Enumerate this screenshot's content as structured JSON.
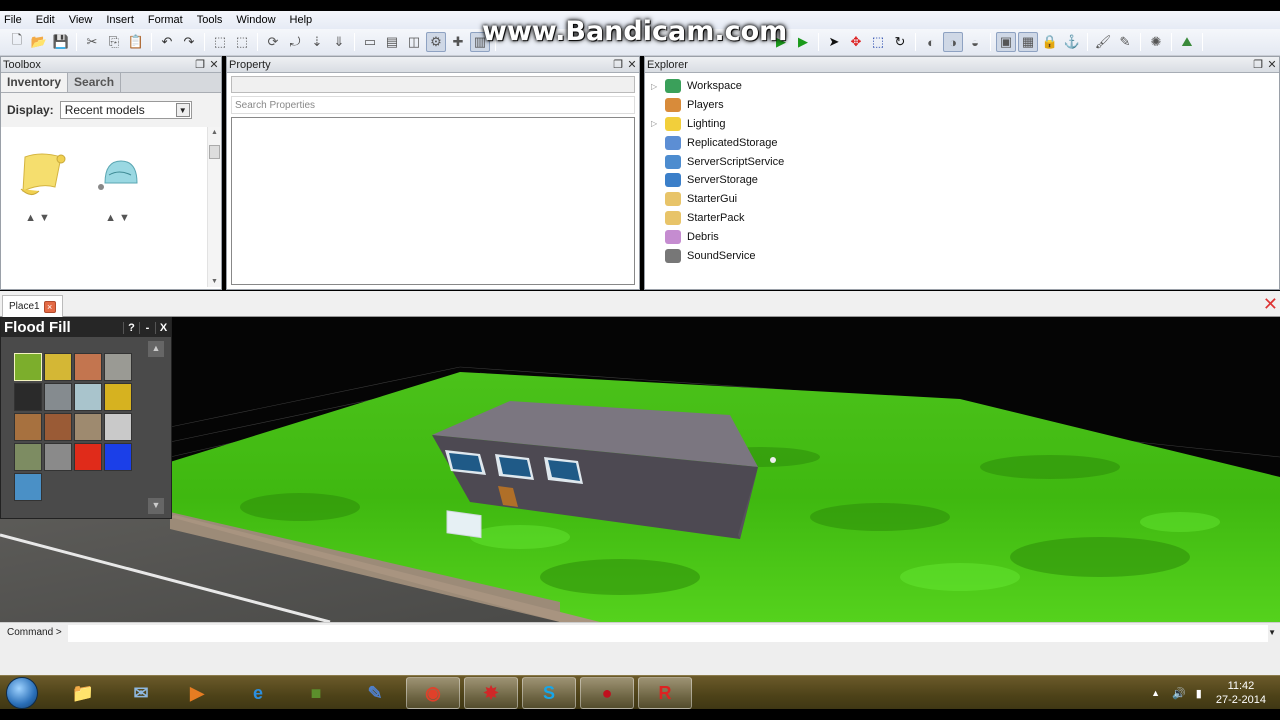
{
  "recording_watermark": "www.Bandicam.com",
  "menu": [
    "File",
    "Edit",
    "View",
    "Insert",
    "Format",
    "Tools",
    "Window",
    "Help"
  ],
  "toolbar": {
    "groups": [
      [
        "new-file-icon",
        "open-folder-icon",
        "save-icon"
      ],
      [
        "cut-icon",
        "copy-icon",
        "paste-icon"
      ],
      [
        "undo-icon",
        "redo-icon"
      ],
      [
        "group-icon",
        "ungroup-icon"
      ],
      [
        "rotate-icon",
        "tilt-icon",
        "drop-icon",
        "anchor-down-icon"
      ],
      [
        "window-icon",
        "windows-icon",
        "preview-icon",
        "tools-icon",
        "plugin-icon",
        "layout-icon"
      ],
      [
        "play-icon",
        "run-icon"
      ],
      [
        "select-icon",
        "move-icon",
        "resize-icon",
        "rotate-tool-icon"
      ],
      [
        "snap-1-icon",
        "snap-fifth-icon",
        "snap-off-icon"
      ],
      [
        "collisions-icon",
        "joints-icon",
        "lock-icon",
        "anchor-icon"
      ],
      [
        "paint-icon",
        "dropper-icon"
      ],
      [
        "material-icon"
      ],
      [
        "terrain-icon"
      ]
    ],
    "play_symbol": "▶",
    "overflow_symbol": "»"
  },
  "toolbox": {
    "title": "Toolbox",
    "tabs": [
      "Inventory",
      "Search"
    ],
    "active_tab": "Inventory",
    "display_label": "Display:",
    "display_value": "Recent models",
    "models": [
      {
        "name": "script-scroll",
        "icon": "scroll-icon"
      },
      {
        "name": "glass-dome",
        "icon": "dome-icon"
      }
    ],
    "rate_up": "👍",
    "rate_down": "👎"
  },
  "property": {
    "title": "Property",
    "search_placeholder": "Search Properties"
  },
  "explorer": {
    "title": "Explorer",
    "items": [
      {
        "label": "Workspace",
        "expandable": true,
        "color": "#3aa05a"
      },
      {
        "label": "Players",
        "expandable": false,
        "color": "#d88b3a"
      },
      {
        "label": "Lighting",
        "expandable": true,
        "color": "#f2cf3b"
      },
      {
        "label": "ReplicatedStorage",
        "expandable": false,
        "color": "#5c8ed4"
      },
      {
        "label": "ServerScriptService",
        "expandable": false,
        "color": "#4d8ccf"
      },
      {
        "label": "ServerStorage",
        "expandable": false,
        "color": "#3b7fc9"
      },
      {
        "label": "StarterGui",
        "expandable": false,
        "color": "#e8c469"
      },
      {
        "label": "StarterPack",
        "expandable": false,
        "color": "#e8c469"
      },
      {
        "label": "Debris",
        "expandable": false,
        "color": "#c58cd0"
      },
      {
        "label": "SoundService",
        "expandable": false,
        "color": "#777777"
      }
    ]
  },
  "doc_tab": {
    "label": "Place1",
    "close": "×"
  },
  "flood_fill": {
    "title": "Flood Fill",
    "help": "?",
    "minimize": "-",
    "close": "X",
    "materials": [
      {
        "name": "grass",
        "color": "#7cae2c"
      },
      {
        "name": "sand",
        "color": "#d4b735"
      },
      {
        "name": "brick",
        "color": "#c3754f"
      },
      {
        "name": "granite",
        "color": "#9a9a94"
      },
      {
        "name": "slate",
        "color": "#2a2a2a"
      },
      {
        "name": "concrete",
        "color": "#858b8f"
      },
      {
        "name": "ice",
        "color": "#a9c4cc"
      },
      {
        "name": "gold",
        "color": "#d6b220"
      },
      {
        "name": "wood-planks",
        "color": "#a7713f"
      },
      {
        "name": "wood",
        "color": "#9a5b36"
      },
      {
        "name": "rock",
        "color": "#9e8a6f"
      },
      {
        "name": "iron-grid",
        "color": "#c9c9c9"
      },
      {
        "name": "moss",
        "color": "#7d8c62"
      },
      {
        "name": "cement",
        "color": "#8a8a8a"
      },
      {
        "name": "red-plastic",
        "color": "#e02b1a"
      },
      {
        "name": "blue-plastic",
        "color": "#1b3fe8"
      },
      {
        "name": "water",
        "color": "#4a90c6"
      }
    ],
    "selected": "grass",
    "scroll_up": "▲",
    "scroll_down": "▼"
  },
  "command": {
    "label": "Command >",
    "value": ""
  },
  "taskbar": {
    "apps": [
      {
        "name": "file-explorer",
        "glyph": "📁",
        "open": false
      },
      {
        "name": "mail",
        "glyph": "✉",
        "open": false
      },
      {
        "name": "media-player",
        "glyph": "▶",
        "open": false
      },
      {
        "name": "internet-explorer",
        "glyph": "e",
        "open": false
      },
      {
        "name": "minecraft",
        "glyph": "■",
        "open": false
      },
      {
        "name": "paint-app",
        "glyph": "✎",
        "open": false
      },
      {
        "name": "chrome",
        "glyph": "◉",
        "open": true
      },
      {
        "name": "app-red",
        "glyph": "✸",
        "open": true
      },
      {
        "name": "skype",
        "glyph": "S",
        "open": true
      },
      {
        "name": "bandicam",
        "glyph": "●",
        "open": true
      },
      {
        "name": "roblox",
        "glyph": "R",
        "open": true
      }
    ],
    "tray": {
      "arrow": "▲",
      "volume": "🔊",
      "signal": "▮"
    },
    "time": "11:42",
    "date": "27-2-2014"
  }
}
